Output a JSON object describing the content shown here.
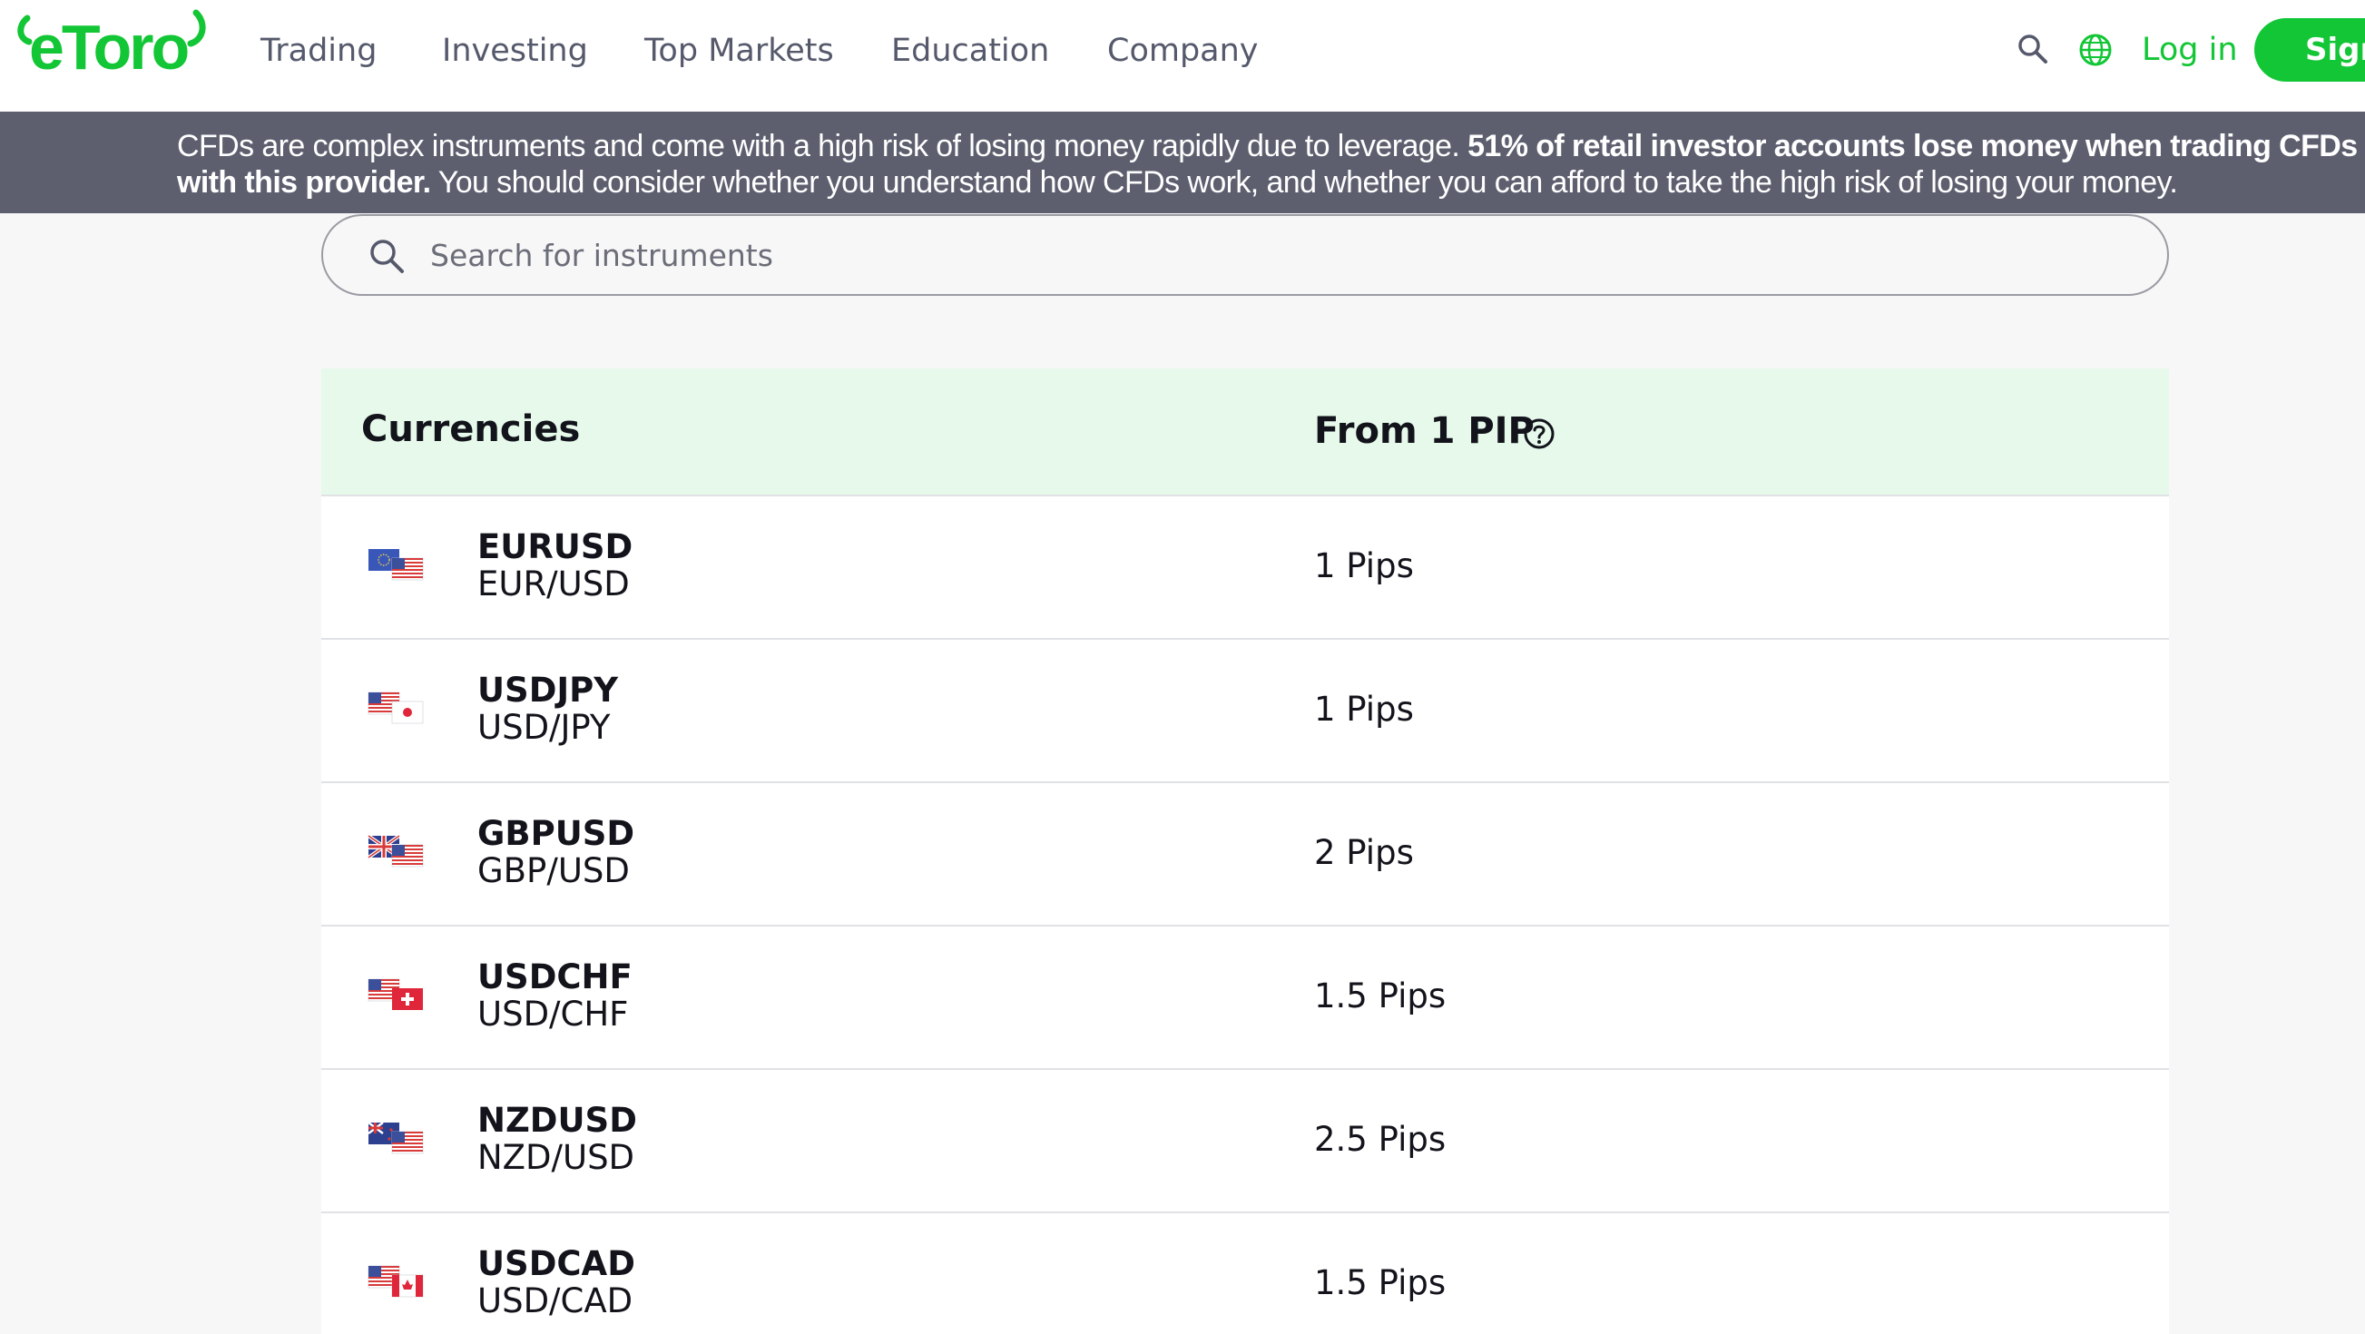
{
  "header": {
    "logo_text": "eToro",
    "nav": [
      "Trading",
      "Investing",
      "Top Markets",
      "Education",
      "Company"
    ],
    "icons": [
      "search-icon",
      "globe-icon"
    ],
    "login_label": "Log in",
    "signup_label": "Sign up",
    "accent_color": "#13c636"
  },
  "risk_banner": {
    "text_start": "CFDs are complex instruments and come with a high risk of losing money rapidly due to leverage. ",
    "text_bold": "51% of retail investor accounts lose money when trading CFDs with this provider.",
    "text_end": " You should consider whether you understand how CFDs work, and whether you can afford to take the high risk of losing your money."
  },
  "search": {
    "placeholder": "Search for instruments"
  },
  "table": {
    "col_currencies": "Currencies",
    "col_pip": "From 1 PIP",
    "rows": [
      {
        "symbol": "EURUSD",
        "pair": "EUR/USD",
        "spread": "1 Pips",
        "flags": [
          "eu-flag-icon",
          "us-flag-icon"
        ]
      },
      {
        "symbol": "USDJPY",
        "pair": "USD/JPY",
        "spread": "1 Pips",
        "flags": [
          "us-flag-icon",
          "jp-flag-icon"
        ]
      },
      {
        "symbol": "GBPUSD",
        "pair": "GBP/USD",
        "spread": "2 Pips",
        "flags": [
          "gb-flag-icon",
          "us-flag-icon"
        ]
      },
      {
        "symbol": "USDCHF",
        "pair": "USD/CHF",
        "spread": "1.5 Pips",
        "flags": [
          "us-flag-icon",
          "ch-flag-icon"
        ]
      },
      {
        "symbol": "NZDUSD",
        "pair": "NZD/USD",
        "spread": "2.5 Pips",
        "flags": [
          "nz-flag-icon",
          "us-flag-icon"
        ]
      },
      {
        "symbol": "USDCAD",
        "pair": "USD/CAD",
        "spread": "1.5 Pips",
        "flags": [
          "us-flag-icon",
          "ca-flag-icon"
        ]
      }
    ]
  }
}
